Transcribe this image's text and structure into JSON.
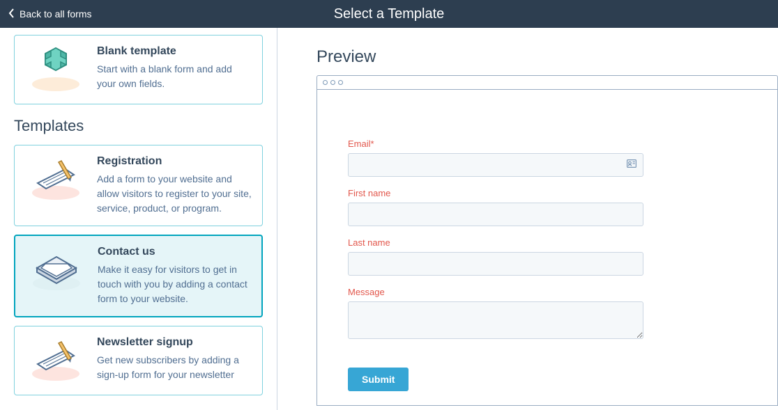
{
  "header": {
    "back_label": "Back to all forms",
    "title": "Select a Template"
  },
  "left": {
    "blank": {
      "title": "Blank template",
      "desc": "Start with a blank form and add your own fields."
    },
    "templates_heading": "Templates",
    "templates": [
      {
        "id": "registration",
        "title": "Registration",
        "desc": "Add a form to your website and allow visitors to register to your site, service, product, or program."
      },
      {
        "id": "contact-us",
        "title": "Contact us",
        "desc": "Make it easy for visitors to get in touch with you by adding a contact form to your website."
      },
      {
        "id": "newsletter",
        "title": "Newsletter signup",
        "desc": "Get new subscribers by adding a sign-up form for your newsletter"
      }
    ]
  },
  "preview": {
    "heading": "Preview",
    "fields": {
      "email_label": "Email*",
      "first_name_label": "First name",
      "last_name_label": "Last name",
      "message_label": "Message"
    },
    "submit_label": "Submit"
  }
}
